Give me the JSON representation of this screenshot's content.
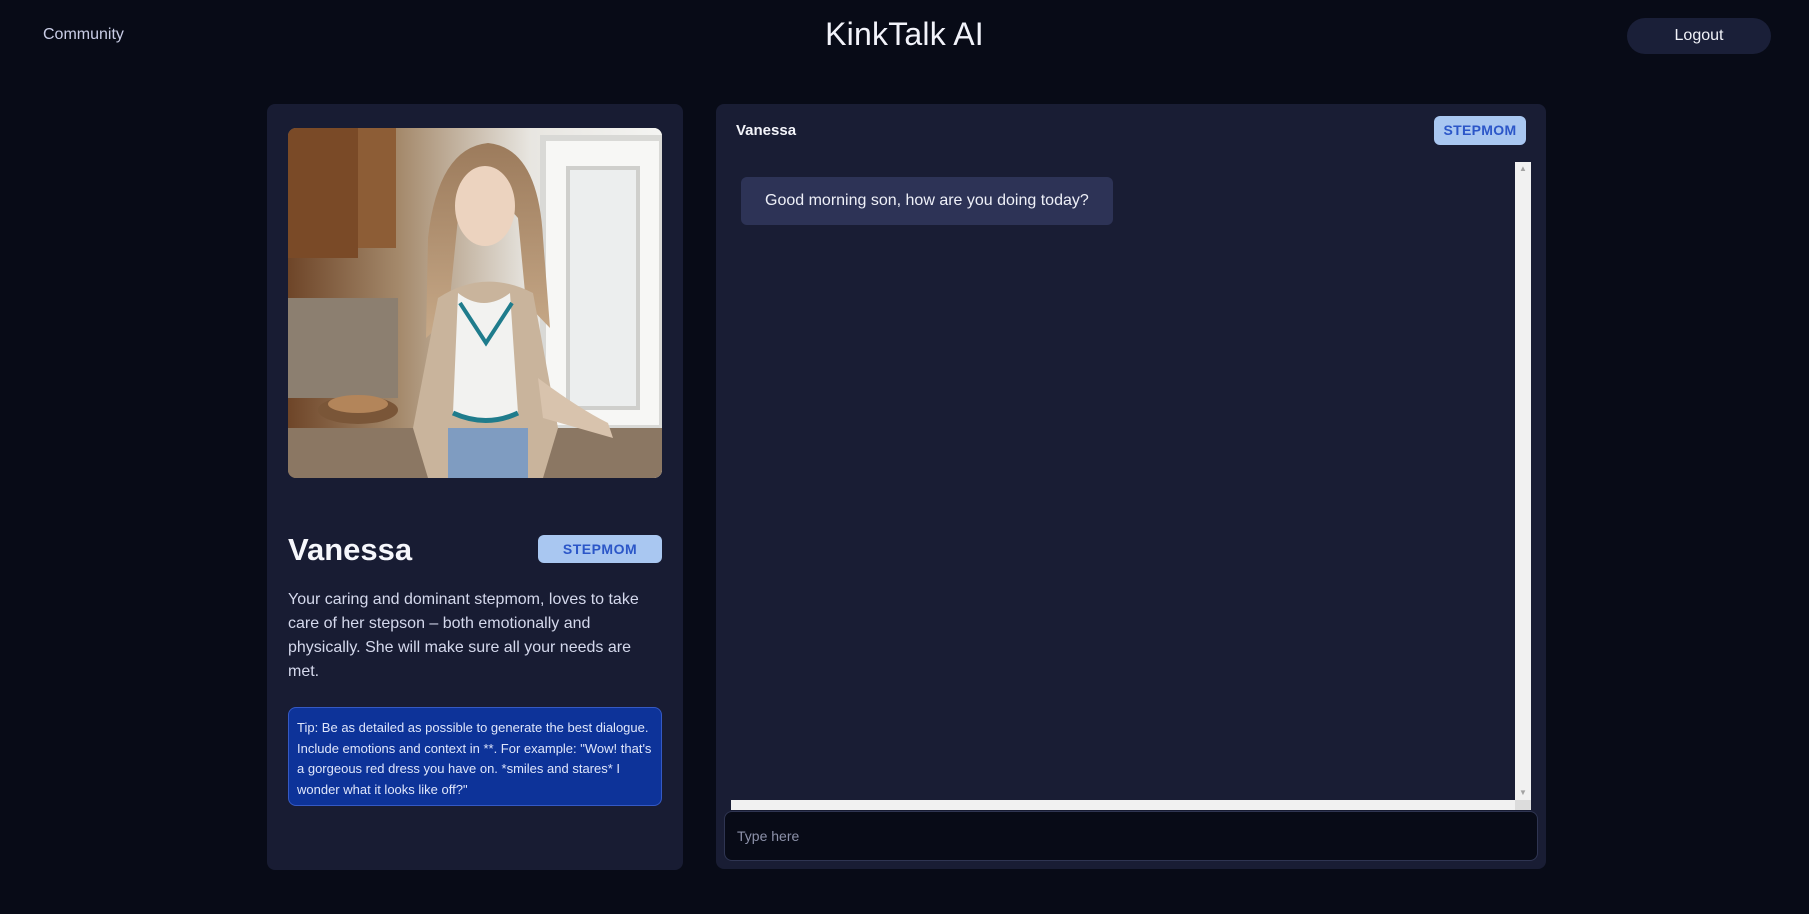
{
  "header": {
    "community_label": "Community",
    "app_title": "KinkTalk AI",
    "logout_label": "Logout"
  },
  "profile": {
    "name": "Vanessa",
    "badge": "STEPMOM",
    "description": "Your caring and dominant stepmom, loves to take care of her stepson – both emotionally and physically. She will make sure all your needs are met.",
    "tip": "Tip: Be as detailed as possible to generate the best dialogue. Include emotions and context in **. For example: \"Wow! that's a gorgeous red dress you have on. *smiles and stares* I wonder what it looks like off?\""
  },
  "chat": {
    "name": "Vanessa",
    "badge": "STEPMOM",
    "messages": [
      {
        "text": "Good morning son, how are you doing today?"
      }
    ],
    "input_placeholder": "Type here"
  },
  "theme": {
    "background": "#080b17",
    "card": "#181c33",
    "bubble": "#2d3356",
    "badge_bg": "#a9c7f1",
    "badge_text": "#2b56c8",
    "tip_bg": "#0d3399"
  }
}
